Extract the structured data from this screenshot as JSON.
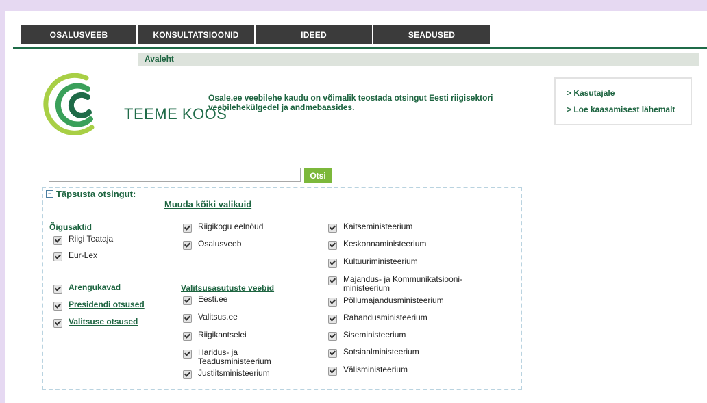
{
  "nav": {
    "tabs": [
      {
        "label": "OSALUSVEEB"
      },
      {
        "label": "KONSULTATSIOONID"
      },
      {
        "label": "IDEED"
      },
      {
        "label": "SEADUSED"
      }
    ],
    "breadcrumb": "Avaleht"
  },
  "logo": {
    "text": "TEEME KOOS"
  },
  "intro": "Osale.ee veebilehe kaudu on võimalik teostada otsingut Eesti riigisektori veebilehekülgedel ja andmebaasides.",
  "sidebar_links": [
    "> Kasutajale",
    "> Loe kaasamisest lähemalt"
  ],
  "search": {
    "value": "",
    "button_label": "Otsi"
  },
  "refine": {
    "label": "Täpsusta otsingut:",
    "change_all": "Muuda kõiki valikuid",
    "col1": {
      "heading": "Õigusaktid",
      "items": [
        {
          "label": "Riigi Teataja",
          "checked": true
        },
        {
          "label": "Eur-Lex",
          "checked": true
        }
      ],
      "link_items": [
        {
          "label": "Arengukavad",
          "checked": true
        },
        {
          "label": "Presidendi otsused",
          "checked": true
        },
        {
          "label": "Valitsuse otsused",
          "checked": true
        }
      ]
    },
    "col2": {
      "items_top": [
        {
          "label": "Riigikogu eelnõud",
          "checked": true
        },
        {
          "label": "Osalusveeb",
          "checked": true
        }
      ],
      "heading": "Valitsusasutuste veebid",
      "items": [
        {
          "label": "Eesti.ee",
          "checked": true
        },
        {
          "label": "Valitsus.ee",
          "checked": true
        },
        {
          "label": "Riigikantselei",
          "checked": true
        },
        {
          "label": "Haridus- ja Teadusministeerium",
          "checked": true
        },
        {
          "label": "Justiitsministeerium",
          "checked": true
        }
      ]
    },
    "col3": {
      "items": [
        {
          "label": "Kaitseministeerium",
          "checked": true
        },
        {
          "label": "Keskonnaministeerium",
          "checked": true
        },
        {
          "label": "Kultuuriministeerium",
          "checked": true
        },
        {
          "label": "Majandus- ja Kommunikatsiooni-ministeerium",
          "checked": true
        },
        {
          "label": "Põllumajandusministeerium",
          "checked": true
        },
        {
          "label": "Rahandusministeerium",
          "checked": true
        },
        {
          "label": "Siseministeerium",
          "checked": true
        },
        {
          "label": "Sotsiaalministeerium",
          "checked": true
        },
        {
          "label": "Välisministeerium",
          "checked": true
        }
      ]
    }
  },
  "colors": {
    "green": "#1d6440",
    "light_green": "#a8cf45",
    "button_green": "#7cb83b",
    "tab_dark": "#3b3b3b"
  }
}
